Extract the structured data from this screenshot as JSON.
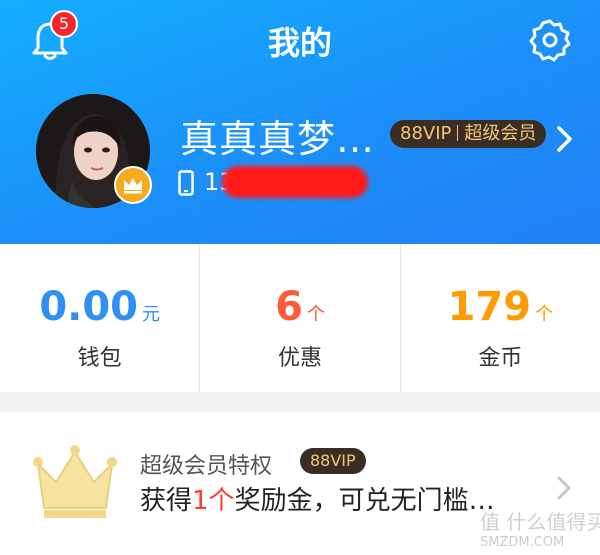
{
  "header": {
    "title": "我的",
    "notification_count": "5",
    "username": "真真真梦…",
    "vip_prefix": "88VIP",
    "vip_label": "超级会员",
    "phone_prefix": "13"
  },
  "stats": [
    {
      "value": "0.00",
      "unit": "元",
      "label": "钱包",
      "color": "#2f8ff2"
    },
    {
      "value": "6",
      "unit": "个",
      "label": "优惠",
      "color": "#ff5a3c"
    },
    {
      "value": "179",
      "unit": "个",
      "label": "金币",
      "color": "#ff9a00"
    }
  ],
  "vip_card": {
    "title": "超级会员特权",
    "badge": "88VIP",
    "desc_pre": "获得",
    "desc_num": "1个",
    "desc_post": "奖励金，可兑无门槛…"
  },
  "watermark": {
    "line1": "值 什么值得买",
    "line2": "SMZDM.COM"
  },
  "colors": {
    "header_blue": "#1c8ff8",
    "vip_dark": "#3a2e24",
    "vip_gold": "#f3c57a",
    "crown_gold": "#f4ab1e",
    "highlight_red": "#ff3b30"
  }
}
